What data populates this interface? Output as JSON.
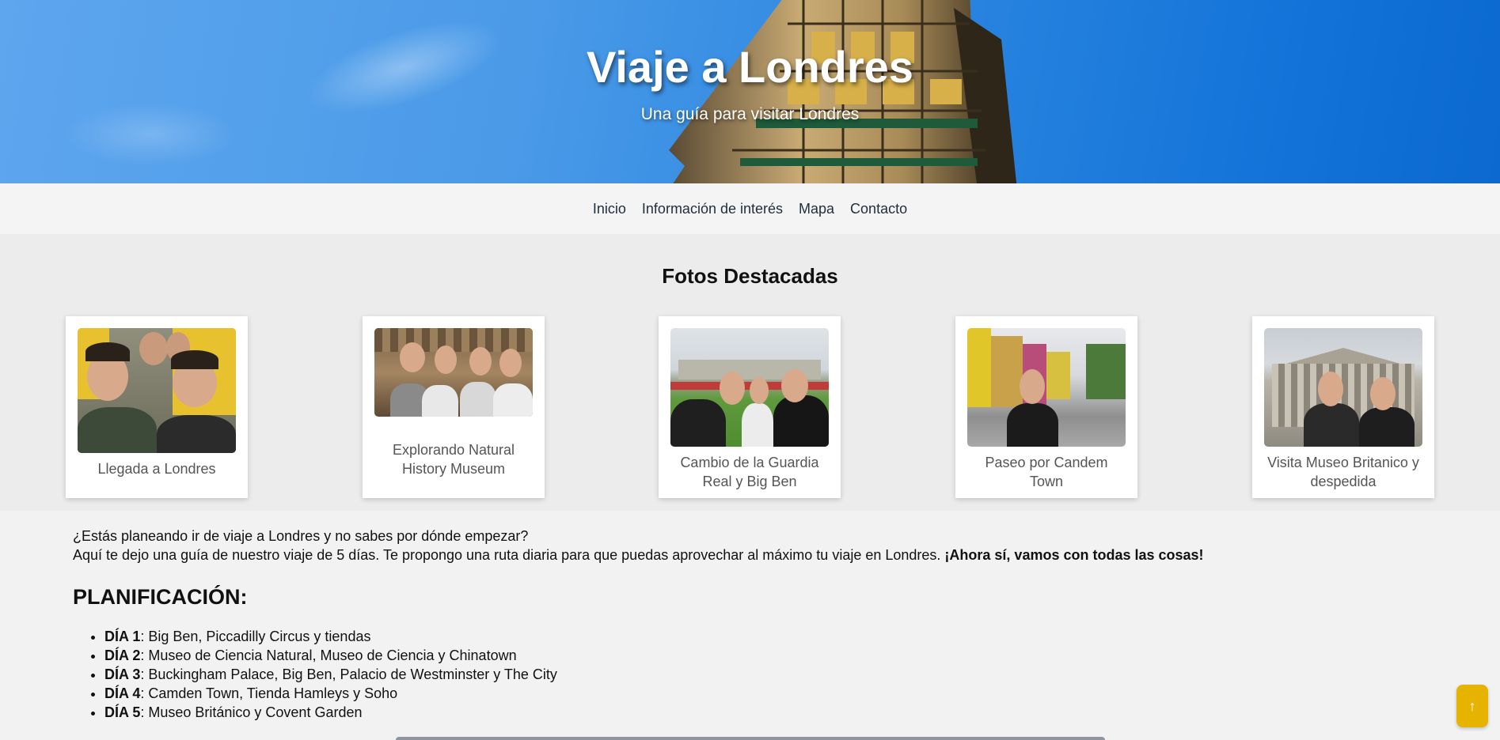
{
  "hero": {
    "title": "Viaje a Londres",
    "subtitle": "Una guía para visitar Londres"
  },
  "nav": {
    "items": [
      {
        "label": "Inicio"
      },
      {
        "label": "Información de interés"
      },
      {
        "label": "Mapa"
      },
      {
        "label": "Contacto"
      }
    ]
  },
  "featured": {
    "heading": "Fotos Destacadas",
    "cards": [
      {
        "caption": "Llegada a Londres"
      },
      {
        "caption": "Explorando Natural History Museum"
      },
      {
        "caption": "Cambio de la Guardia Real y Big Ben"
      },
      {
        "caption": "Paseo por Candem Town"
      },
      {
        "caption": "Visita Museo Britanico y despedida"
      }
    ]
  },
  "intro": {
    "line1": "¿Estás planeando ir de viaje a Londres y no sabes por dónde empezar?",
    "line2": "Aquí te dejo una guía de nuestro viaje de 5 días. Te propongo una ruta diaria para que puedas aprovechar al máximo tu viaje en Londres. ",
    "line2_bold": "¡Ahora sí, vamos con todas las cosas!"
  },
  "plan": {
    "heading": "PLANIFICACIÓN:",
    "days": [
      {
        "day": "DÍA 1",
        "text": ": Big Ben, Piccadilly Circus y tiendas"
      },
      {
        "day": "DÍA 2",
        "text": ": Museo de Ciencia Natural, Museo de Ciencia y Chinatown"
      },
      {
        "day": "DÍA 3",
        "text": ": Buckingham Palace, Big Ben, Palacio de Westminster y The City"
      },
      {
        "day": "DÍA 4",
        "text": ": Camden Town, Tienda Hamleys y Soho"
      },
      {
        "day": "DÍA 5",
        "text": ": Museo Británico y Covent Garden"
      }
    ]
  },
  "back_to_top": {
    "icon": "arrow-up-icon",
    "glyph": "↑",
    "color": "#e6b400"
  }
}
